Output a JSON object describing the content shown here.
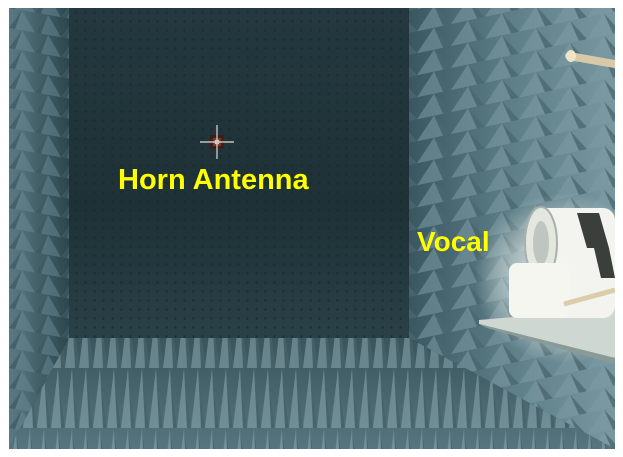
{
  "scene": {
    "description_icon": "anechoic-chamber-photo",
    "labels": {
      "horn_antenna": "Horn Antenna",
      "vocal": "Vocal"
    },
    "colors": {
      "label_text": "#ffff00",
      "absorber_wall": "#2f4a52",
      "absorber_floor": "#3d5860",
      "back_wall": "#1f3338",
      "device_light": "#f2f2ec"
    }
  }
}
